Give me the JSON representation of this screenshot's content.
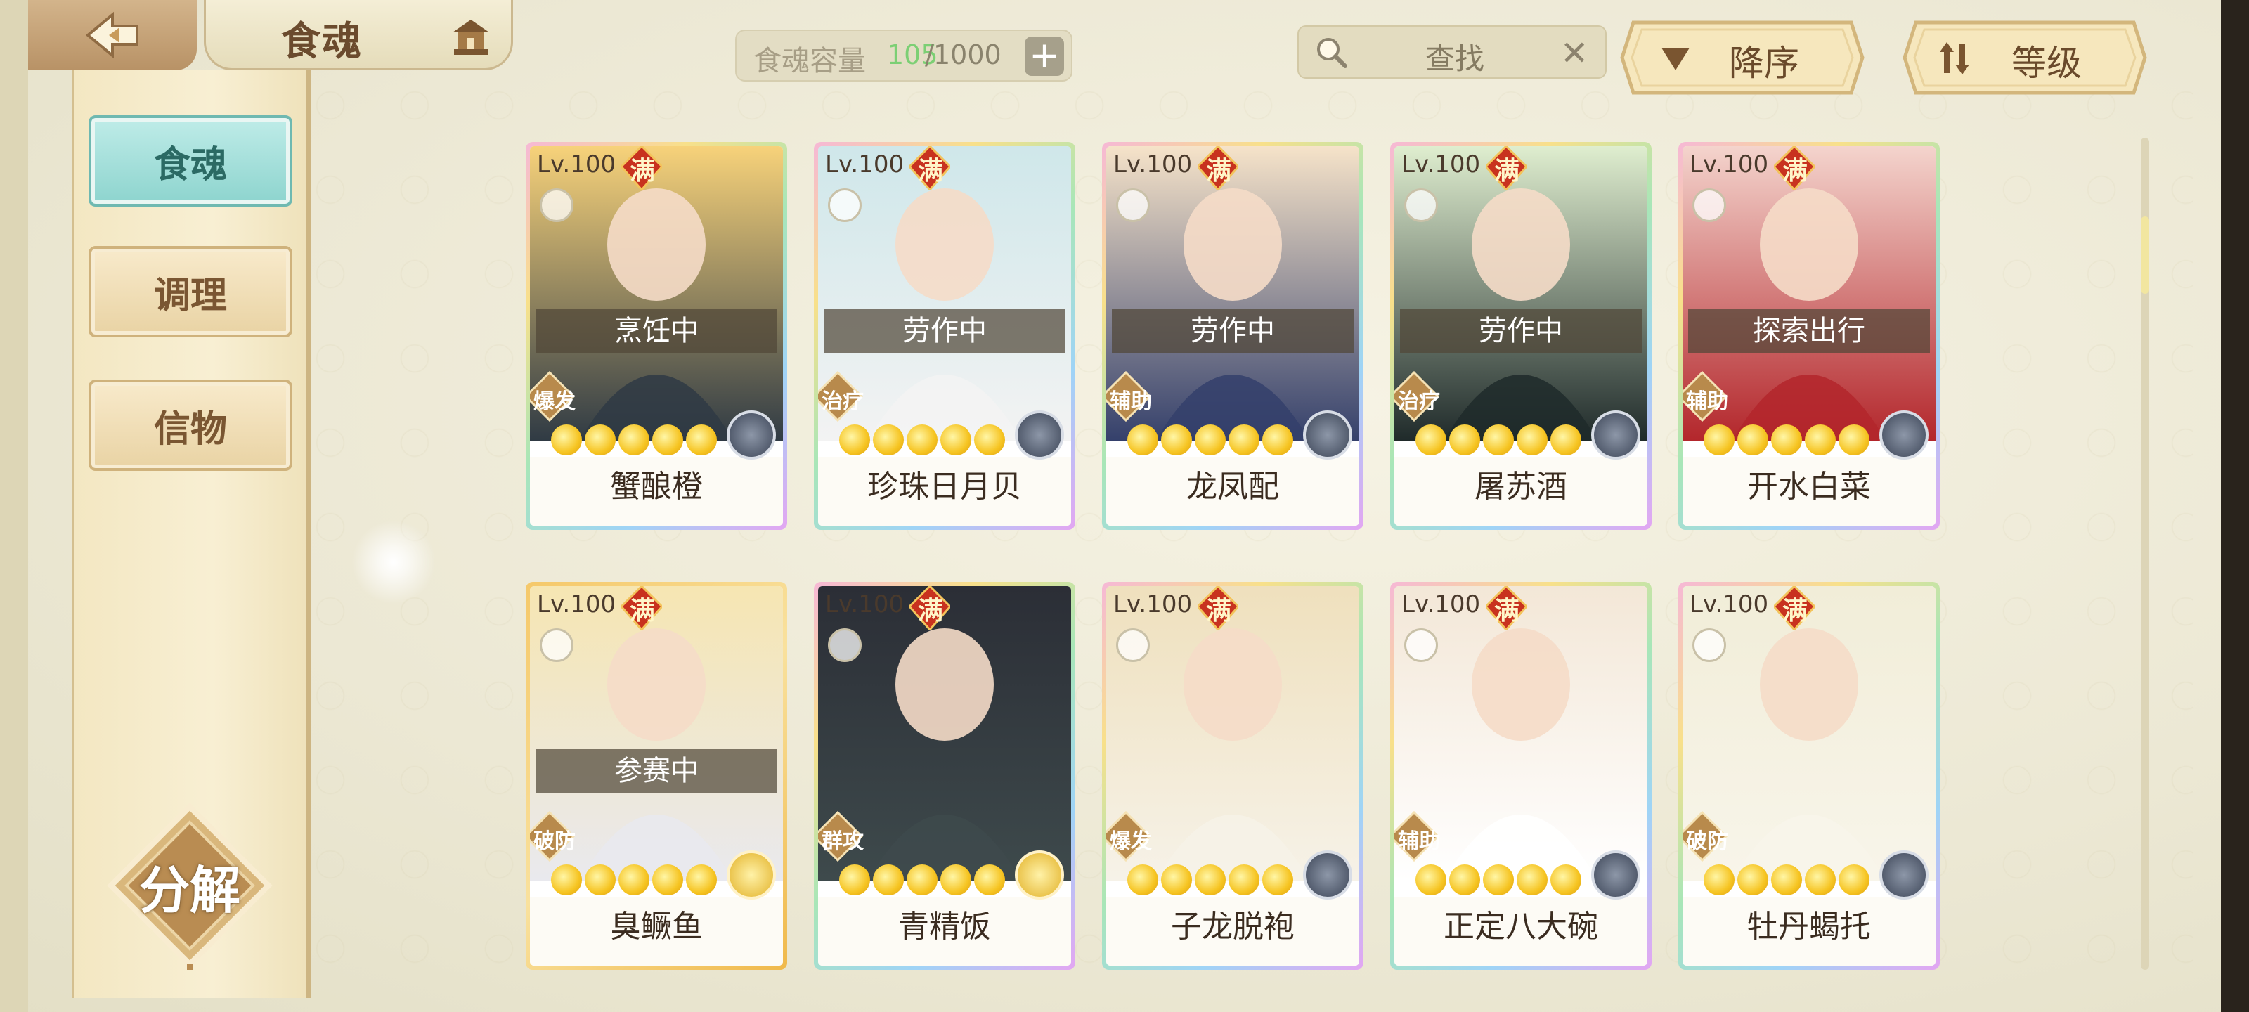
{
  "header": {
    "title": "食魂",
    "capacity_label": "食魂容量",
    "capacity_current": "105",
    "capacity_separator": "/",
    "capacity_max": "1000",
    "search_label": "查找",
    "sort_order_label": "降序",
    "sort_key_label": "等级"
  },
  "sidebar": {
    "items": [
      {
        "label": "食魂"
      },
      {
        "label": "调理"
      },
      {
        "label": "信物"
      }
    ],
    "decompose_label": "分解"
  },
  "cards": [
    {
      "level": "Lv.100",
      "full": "满",
      "name": "蟹酿橙",
      "status": "烹饪中",
      "role": "爆发",
      "stars": 5,
      "frame": "rainbow",
      "element": "silver"
    },
    {
      "level": "Lv.100",
      "full": "满",
      "name": "珍珠日月贝",
      "status": "劳作中",
      "role": "治疗",
      "stars": 5,
      "frame": "rainbow",
      "element": "silver"
    },
    {
      "level": "Lv.100",
      "full": "满",
      "name": "龙凤配",
      "status": "劳作中",
      "role": "辅助",
      "stars": 5,
      "frame": "rainbow",
      "element": "silver"
    },
    {
      "level": "Lv.100",
      "full": "满",
      "name": "屠苏酒",
      "status": "劳作中",
      "role": "治疗",
      "stars": 5,
      "frame": "rainbow",
      "element": "silver"
    },
    {
      "level": "Lv.100",
      "full": "满",
      "name": "开水白菜",
      "status": "探索出行",
      "role": "辅助",
      "stars": 5,
      "frame": "rainbow",
      "element": "silver"
    },
    {
      "level": "Lv.100",
      "full": "满",
      "name": "臭鳜鱼",
      "status": "参赛中",
      "role": "破防",
      "stars": 5,
      "frame": "gold",
      "element": "gold"
    },
    {
      "level": "Lv.100",
      "full": "满",
      "name": "青精饭",
      "status": "",
      "role": "群攻",
      "stars": 5,
      "frame": "rainbow",
      "element": "gold"
    },
    {
      "level": "Lv.100",
      "full": "满",
      "name": "子龙脱袍",
      "status": "",
      "role": "爆发",
      "stars": 5,
      "frame": "rainbow",
      "element": "silver"
    },
    {
      "level": "Lv.100",
      "full": "满",
      "name": "正定八大碗",
      "status": "",
      "role": "辅助",
      "stars": 5,
      "frame": "rainbow",
      "element": "silver"
    },
    {
      "level": "Lv.100",
      "full": "满",
      "name": "牡丹蝎托",
      "status": "",
      "role": "破防",
      "stars": 5,
      "frame": "rainbow",
      "element": "silver"
    }
  ],
  "colors": {
    "accent_green": "#7ccf74",
    "active_tab": "#8dd4ce",
    "brown_text": "#6b4b2e"
  }
}
